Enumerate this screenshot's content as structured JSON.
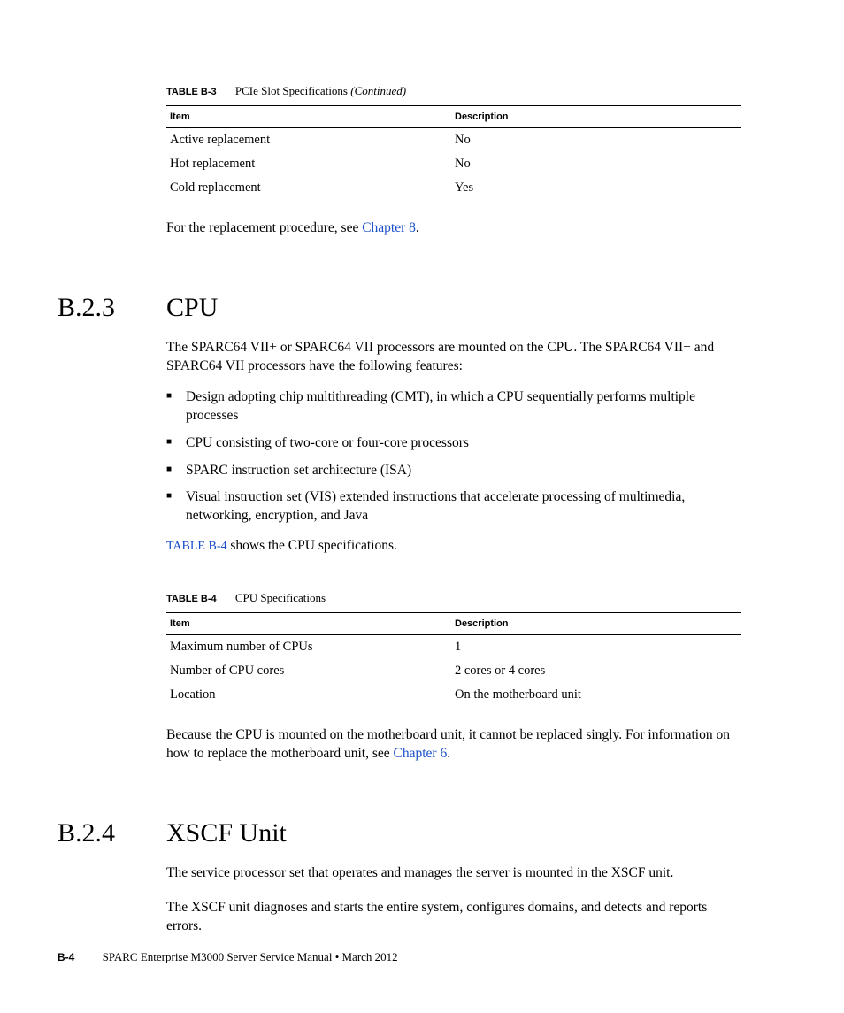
{
  "tableB3": {
    "label": "TABLE B-3",
    "title": "PCIe Slot Specifications ",
    "cont": "(Continued)",
    "headers": {
      "item": "Item",
      "desc": "Description"
    },
    "rows": [
      {
        "item": "Active replacement",
        "desc": "No"
      },
      {
        "item": "Hot replacement",
        "desc": "No"
      },
      {
        "item": "Cold replacement",
        "desc": "Yes"
      }
    ]
  },
  "replace_text_pre": "For the replacement procedure, see ",
  "replace_link": "Chapter 8",
  "replace_text_post": ".",
  "sectionB23": {
    "num": "B.2.3",
    "title": "CPU"
  },
  "cpu_intro": "The SPARC64 VII+ or SPARC64 VII processors are mounted on the CPU. The SPARC64 VII+ and SPARC64 VII processors have the following features:",
  "cpu_features": [
    "Design adopting chip multithreading (CMT), in which a CPU sequentially performs multiple processes",
    "CPU consisting of two-core or four-core processors",
    "SPARC instruction set architecture (ISA)",
    "Visual instruction set (VIS) extended instructions that accelerate processing of multimedia, networking, encryption, and Java"
  ],
  "cpu_xref_link": "TABLE B-4",
  "cpu_xref_post": " shows the CPU specifications.",
  "tableB4": {
    "label": "TABLE B-4",
    "title": "CPU Specifications",
    "headers": {
      "item": "Item",
      "desc": "Description"
    },
    "rows": [
      {
        "item": "Maximum number of CPUs",
        "desc": "1"
      },
      {
        "item": "Number of CPU cores",
        "desc": "2 cores or 4 cores"
      },
      {
        "item": "Location",
        "desc": "On the motherboard unit"
      }
    ]
  },
  "cpu_note_pre": "Because the CPU is mounted on the motherboard unit, it cannot be replaced singly. For information on how to replace the motherboard unit, see ",
  "cpu_note_link": "Chapter 6",
  "cpu_note_post": ".",
  "sectionB24": {
    "num": "B.2.4",
    "title": "XSCF Unit"
  },
  "xscf_p1": "The service processor set that operates and manages the server is mounted in the XSCF unit.",
  "xscf_p2": "The XSCF unit diagnoses and starts the entire system, configures domains, and detects and reports errors.",
  "footer": {
    "page": "B-4",
    "text": "SPARC Enterprise M3000 Server Service Manual • March 2012"
  }
}
